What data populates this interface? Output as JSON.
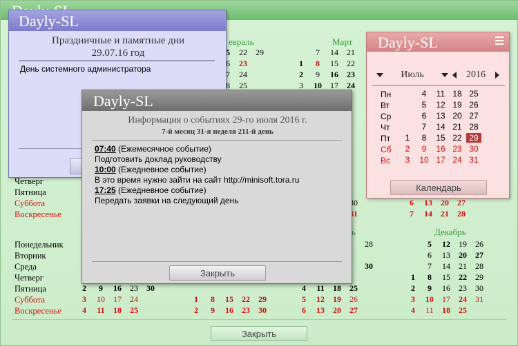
{
  "main": {
    "title": "Dayly-SL",
    "months": [
      "Февраль",
      "Март",
      "Ноябрь",
      "Декабрь"
    ],
    "weekdays": [
      "Понедельник",
      "Вторник",
      "Среда",
      "Четверг",
      "Пятница",
      "Суббота",
      "Воскресенье"
    ],
    "close_label": "Закрыть"
  },
  "holidays": {
    "title": "Dayly-SL",
    "heading": "Праздничные и памятные дни",
    "date": "29.07.16 год",
    "event": "День системного администратора"
  },
  "events": {
    "title": "Dayly-SL",
    "heading": "Информация о событиях 29-го июля 2016 г.",
    "subheading": "7-й месяц  31-я неделя  211-й день",
    "items": [
      {
        "time": "07:40",
        "type": "(Ежемесячное событие)",
        "text": "Подготовить доклад руководству"
      },
      {
        "time": "10:00",
        "type": "(Ежедневное событие)",
        "text": "В это время нужно зайти на сайт  http://minisoft.tora.ru"
      },
      {
        "time": "17:25",
        "type": "(Ежедневное событие)",
        "text": "Передать заявки на следующий день"
      }
    ],
    "close_label": "Закрыть"
  },
  "mini": {
    "title": "Dayly-SL",
    "month": "Июль",
    "year": "2016",
    "weekdays": [
      "Пн",
      "Вт",
      "Ср",
      "Чт",
      "Пт",
      "Сб",
      "Вс"
    ],
    "button_label": "Календарь"
  },
  "colors": {
    "main_title": "#70bd70",
    "holidays_title": "#7b7bcc",
    "events_title": "#6f6f6f",
    "mini_title": "#d38484",
    "weekend": "#cc1111",
    "today": "#b23a3a"
  }
}
